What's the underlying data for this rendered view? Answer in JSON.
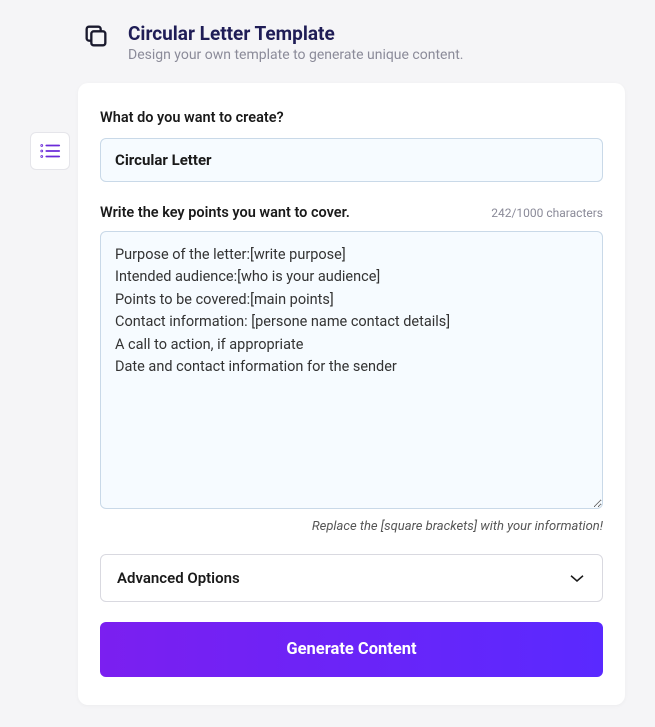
{
  "header": {
    "title": "Circular Letter Template",
    "subtitle": "Design your own template to generate unique content."
  },
  "create": {
    "label": "What do you want to create?",
    "value": "Circular Letter"
  },
  "keypoints": {
    "label": "Write the key points you want to cover.",
    "counter": "242/1000 characters",
    "value": "Purpose of the letter:[write purpose]\nIntended audience:[who is your audience]\nPoints to be covered:[main points]\nContact information: [persone name contact details]\nA call to action, if appropriate\nDate and contact information for the sender",
    "hint": "Replace the [square brackets] with your information!"
  },
  "advanced": {
    "label": "Advanced Options"
  },
  "button": {
    "generate": "Generate Content"
  }
}
